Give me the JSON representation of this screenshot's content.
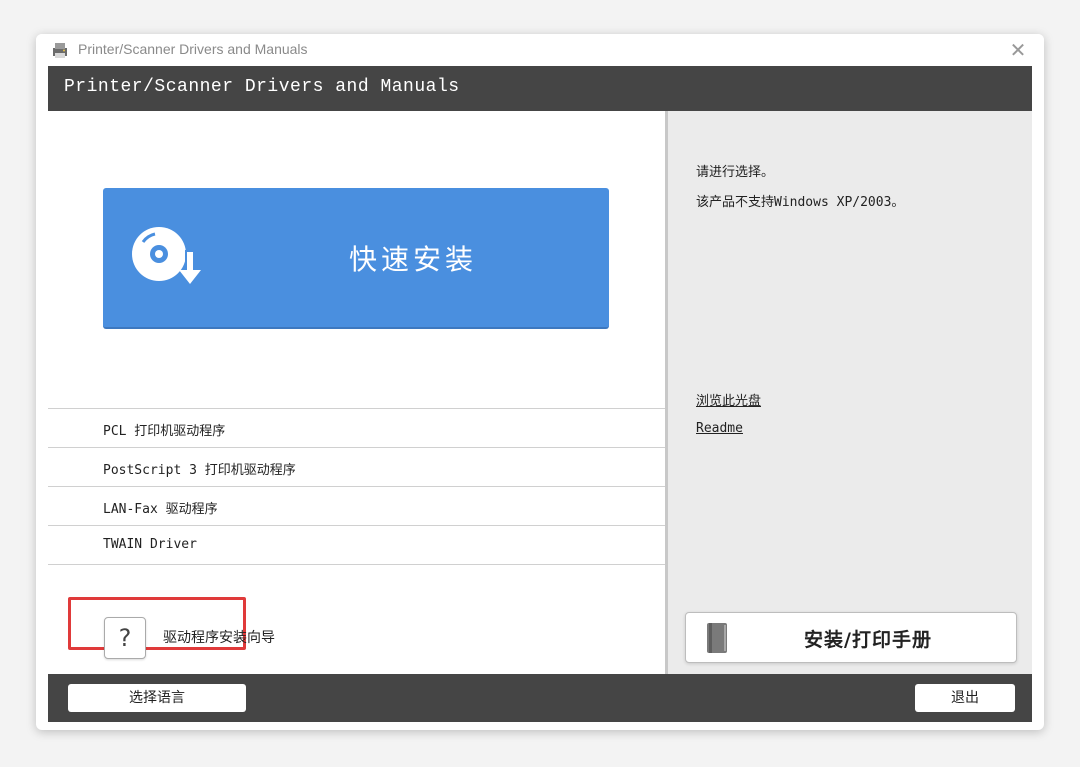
{
  "window": {
    "title": "Printer/Scanner Drivers and Manuals",
    "close_glyph": "✕"
  },
  "header": {
    "title": "Printer/Scanner Drivers and Manuals"
  },
  "left": {
    "quick_install_label": "快速安装",
    "drivers": [
      {
        "label": "PCL 打印机驱动程序"
      },
      {
        "label": "PostScript 3 打印机驱动程序"
      },
      {
        "label": "LAN-Fax 驱动程序"
      },
      {
        "label": "TWAIN Driver"
      }
    ],
    "help": {
      "glyph": "?",
      "label": "驱动程序安装向导"
    }
  },
  "right": {
    "info_lines": [
      "请进行选择。",
      "该产品不支持Windows XP/2003。"
    ],
    "links": [
      "浏览此光盘",
      "Readme"
    ],
    "manual_button_label": "安装/打印手册"
  },
  "footer": {
    "language_button": "选择语言",
    "exit_button": "退出"
  },
  "icons": {
    "app": "printer-scanner-app-icon",
    "quick_install": "disc-download-icon",
    "manual": "book-icon",
    "help": "question-icon"
  },
  "colors": {
    "header_bg": "#454545",
    "quick_install_bg": "#4a8fdf",
    "right_panel_bg": "#ebebeb",
    "highlight": "#e03a3a"
  }
}
